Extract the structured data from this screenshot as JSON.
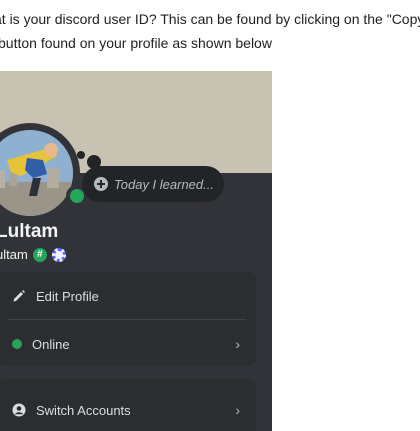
{
  "question": {
    "line1": "at is your discord user ID? This can be found by clicking on the \"Copy User",
    "line2": "button found on your profile as shown below"
  },
  "profile": {
    "custom_status_placeholder": "Today I learned...",
    "display_name": "Lultam",
    "username": "ultam",
    "badges": [
      "hash-badge-icon",
      "gear-badge-icon"
    ],
    "status_color": "#23a55a"
  },
  "menu": {
    "edit_profile": "Edit Profile",
    "online": "Online",
    "switch_accounts": "Switch Accounts"
  },
  "colors": {
    "banner": "#c7c2b1",
    "card": "#313338",
    "menu_bg": "#2b2d31",
    "online": "#23a55a",
    "accent": "#5865f2"
  }
}
